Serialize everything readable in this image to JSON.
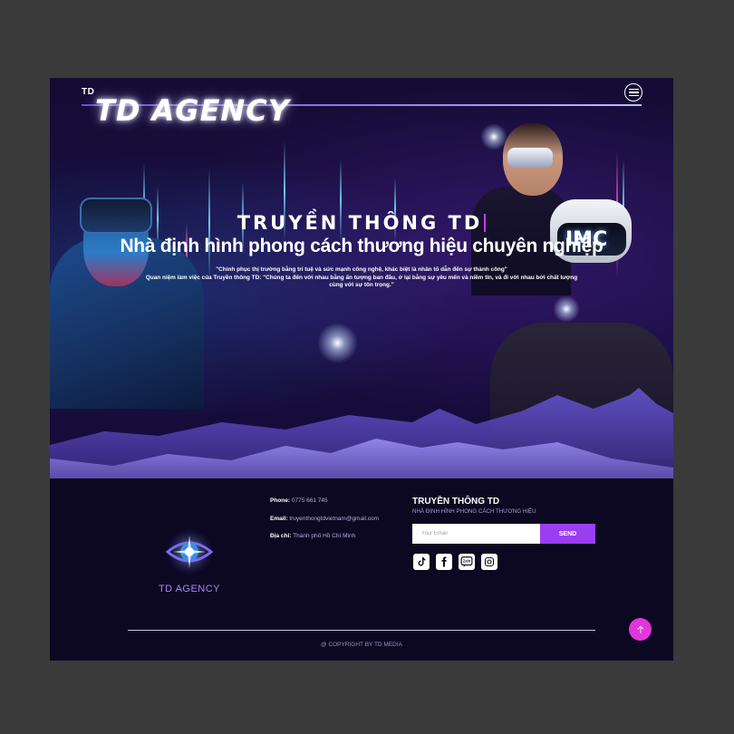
{
  "header": {
    "small_logo": "TD",
    "wordmark": "TD AGENCY",
    "menu_icon": "hamburger-menu-icon"
  },
  "hero": {
    "title": "TRUYỀN THÔNG TD",
    "subtitle": "Nhà định hình phong cách thương hiệu chuyên nghiệp",
    "quote_line1": "\"Chinh phục thị trường bằng trí tuệ và sức mạnh công nghệ, khác biệt là nhân tố dẫn đến sự thành công\"",
    "quote_line2": "Quan niệm làm việc của Truyền thông TD: \"Chúng ta đến với nhau bằng ấn tượng ban đầu, ở lại bằng sự yêu mến và niềm tin, và đi với nhau bởi chất lượng",
    "quote_line3": "cùng với sự tôn trọng.\"",
    "headset_text": "IMC"
  },
  "footer": {
    "logo_text": "TD AGENCY",
    "contact": {
      "phone_label": "Phone:",
      "phone": "0775 661 745",
      "email_label": "Email:",
      "email": "truyenthongtdvietnam@gmail.com",
      "address_label": "Địa chỉ:",
      "address": "Thành phố Hồ Chí Minh"
    },
    "brand_title": "TRUYỀN THÔNG TD",
    "brand_tagline": "NHÀ ĐỊNH HÌNH PHONG CÁCH THƯƠNG HIỆU",
    "newsletter": {
      "placeholder": "Your Email",
      "send_label": "SEND"
    },
    "social": [
      "tiktok-icon",
      "facebook-icon",
      "zalo-icon",
      "instagram-icon"
    ],
    "zalo_label": "Zalo",
    "copyright": "@ COPYRIGHT BY TD MEDIA"
  },
  "colors": {
    "page_bg": "#3a3a3a",
    "frame_bg": "#0c0822",
    "accent_purple": "#9b3df0",
    "scroll_top_pink": "#e236d8",
    "logo_text": "#a487f2"
  }
}
